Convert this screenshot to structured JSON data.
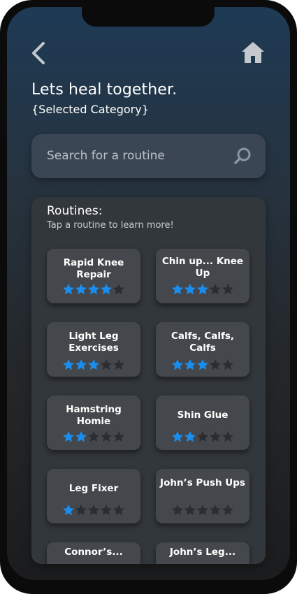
{
  "header": {
    "title": "Lets heal together.",
    "subtitle": "{Selected Category}"
  },
  "search": {
    "placeholder": "Search for a routine"
  },
  "routines": {
    "title": "Routines:",
    "hint": "Tap a routine to learn more!",
    "items": [
      {
        "name": "Rapid Knee Repair",
        "rating": 4
      },
      {
        "name": "Chin up... Knee Up",
        "rating": 3
      },
      {
        "name": "Light Leg Exercises",
        "rating": 3
      },
      {
        "name": "Calfs, Calfs, Calfs",
        "rating": 3
      },
      {
        "name": "Hamstring Homie",
        "rating": 2
      },
      {
        "name": "Shin Glue",
        "rating": 2
      },
      {
        "name": "Leg Fixer",
        "rating": 1
      },
      {
        "name": "John’s Push Ups",
        "rating": 0
      },
      {
        "name": "Connor’s...",
        "rating": 0
      },
      {
        "name": "John’s Leg...",
        "rating": 0
      }
    ],
    "max_rating": 5
  },
  "colors": {
    "star_filled": "#1a8ef0",
    "star_empty": "#2a2d31",
    "accent_icon": "#c4c9ce"
  },
  "icons": {
    "back": "chevron-left-icon",
    "home": "home-icon",
    "search": "search-icon",
    "star": "star-icon"
  }
}
